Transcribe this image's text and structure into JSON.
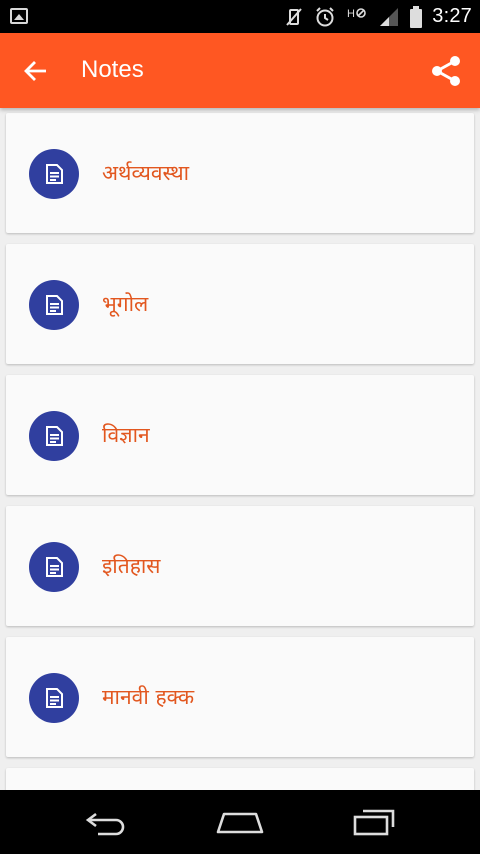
{
  "status_bar": {
    "time": "3:27",
    "network_label": "H"
  },
  "app_bar": {
    "title": "Notes",
    "background": "#ff5722",
    "back_icon": "arrow-left-icon",
    "share_icon": "share-icon"
  },
  "list": {
    "item_icon": "note-document-icon",
    "accent": "#303f9f",
    "text_color": "#e2571f",
    "items": [
      {
        "label": "अर्थव्यवस्था"
      },
      {
        "label": "भूगोल"
      },
      {
        "label": "विज्ञान"
      },
      {
        "label": "इतिहास"
      },
      {
        "label": "मानवी हक्क"
      },
      {
        "label": ""
      }
    ]
  },
  "nav_bar": {
    "back_icon": "nav-back-icon",
    "home_icon": "nav-home-icon",
    "recents_icon": "nav-recents-icon"
  }
}
